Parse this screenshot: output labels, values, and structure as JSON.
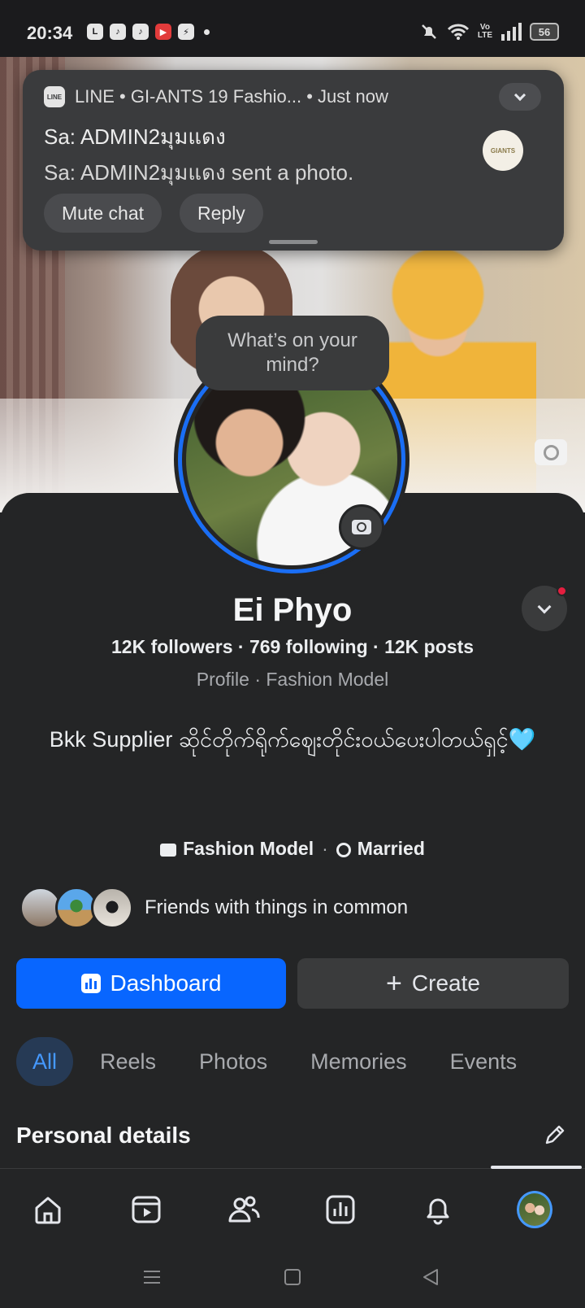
{
  "status_bar": {
    "time": "20:34",
    "app_icons": [
      "line-icon",
      "tiktok-icon",
      "tiktok-icon",
      "youtube-icon",
      "messenger-icon"
    ],
    "battery": "56",
    "network_label_top": "Vo",
    "network_label_bottom": "LTE"
  },
  "notification": {
    "app_name": "LINE",
    "logo_text": "LINE",
    "header": "LINE • GI-ANTS 19 Fashio...  • Just now",
    "title": "Sa: ADMIN2มุมแดง",
    "body": "Sa: ADMIN2มุมแดง sent a photo.",
    "thumb_text": "GIANTS",
    "actions": [
      "Mute chat",
      "Reply"
    ]
  },
  "thought_bubble": "What’s on your mind?",
  "profile": {
    "name": "Ei Phyo",
    "stats": "12K followers · 769 following · 12K posts",
    "subtitle": "Profile · Fashion Model",
    "bio": "Bkk  Supplier ဆိုင်တိုက်ရိုက်ဈေးတိုင်းဝယ်ပေးပါတယ်ရှင့်",
    "bio_emoji": "🩵",
    "tag_job": "Fashion Model",
    "tag_separator": "·",
    "tag_relationship": "Married",
    "friends_text": "Friends with things in common"
  },
  "buttons": {
    "dashboard": "Dashboard",
    "create_plus": "+",
    "create": "Create"
  },
  "tabs": [
    "All",
    "Reels",
    "Photos",
    "Memories",
    "Events"
  ],
  "section_title": "Personal details",
  "bottom_nav": [
    "home-icon",
    "video-icon",
    "friends-icon",
    "dashboard-icon",
    "bell-icon",
    "profile-avatar"
  ],
  "colors": {
    "background": "#242526",
    "primary": "#0866ff",
    "accent_text": "#4599ff",
    "notification_dot": "#e41e3f"
  }
}
